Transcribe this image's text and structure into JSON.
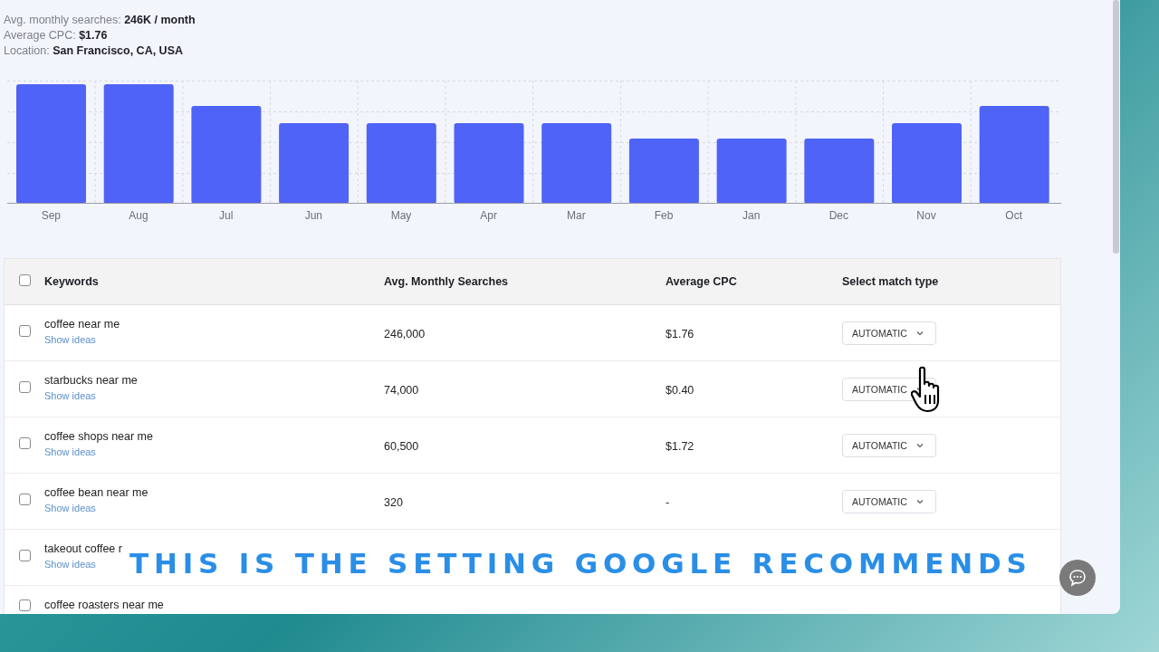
{
  "stats": [
    {
      "label": "Avg. monthly searches: ",
      "value": "246K / month"
    },
    {
      "label": "Average CPC: ",
      "value": "$1.76"
    },
    {
      "label": "Location: ",
      "value": "San Francisco, CA, USA"
    }
  ],
  "chart": {
    "kind": "picture",
    "months": [
      "Sep",
      "Aug",
      "Jul",
      "Jun",
      "May",
      "Apr",
      "Mar",
      "Feb",
      "Jan",
      "Dec",
      "Nov",
      "Oct"
    ]
  },
  "table": {
    "header_checked": false,
    "columns": [
      "Keywords",
      "Avg. Monthly Searches",
      "Average CPC",
      "Select match type"
    ],
    "rows": [
      {
        "keyword": "coffee near me",
        "link": "Show ideas",
        "searches": "246,000",
        "cpc": "$1.76",
        "match_type": "AUTOMATIC",
        "checked": false
      },
      {
        "keyword": "starbucks near me",
        "link": "Show ideas",
        "searches": "74,000",
        "cpc": "$0.40",
        "match_type": "AUTOMATIC",
        "checked": false
      },
      {
        "keyword": "coffee shops near me",
        "link": "Show ideas",
        "searches": "60,500",
        "cpc": "$1.72",
        "match_type": "AUTOMATIC",
        "checked": false
      },
      {
        "keyword": "coffee bean near me",
        "link": "Show ideas",
        "searches": "320",
        "cpc": "-",
        "match_type": "AUTOMATIC",
        "checked": false
      },
      {
        "keyword": "takeout coffee r",
        "link": "Show ideas",
        "checked": false
      },
      {
        "keyword": "coffee roasters near me",
        "checked": false
      }
    ]
  },
  "caption": "THIS IS THE SETTING GOOGLE RECOMMENDS"
}
